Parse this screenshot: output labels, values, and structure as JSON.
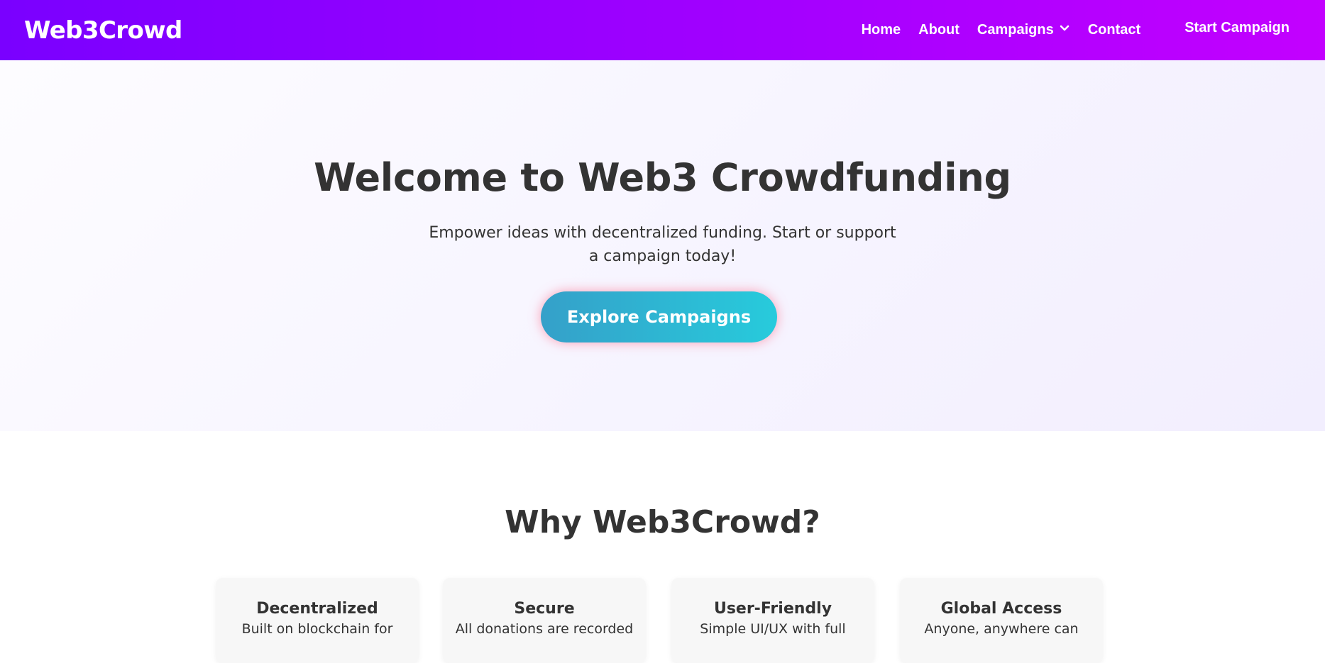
{
  "nav": {
    "brand": "Web3Crowd",
    "links": {
      "home": "Home",
      "about": "About",
      "campaigns": "Campaigns",
      "contact": "Contact"
    },
    "cta": "Start Campaign"
  },
  "hero": {
    "title": "Welcome to Web3 Crowdfunding",
    "subtitle": "Empower ideas with decentralized funding. Start or support a campaign today!",
    "button": "Explore Campaigns"
  },
  "why": {
    "title": "Why Web3Crowd?",
    "features": [
      {
        "title": "Decentralized",
        "desc": "Built on blockchain for"
      },
      {
        "title": "Secure",
        "desc": "All donations are recorded"
      },
      {
        "title": "User-Friendly",
        "desc": "Simple UI/UX with full"
      },
      {
        "title": "Global Access",
        "desc": "Anyone, anywhere can"
      }
    ]
  },
  "colors": {
    "nav_gradient_start": "#7a00ff",
    "nav_gradient_end": "#c300ff",
    "button_gradient_start": "#35a0c9",
    "button_gradient_end": "#27cbdc",
    "text": "#333333"
  },
  "icons": {
    "campaigns_dropdown": "chevron-down-icon"
  }
}
